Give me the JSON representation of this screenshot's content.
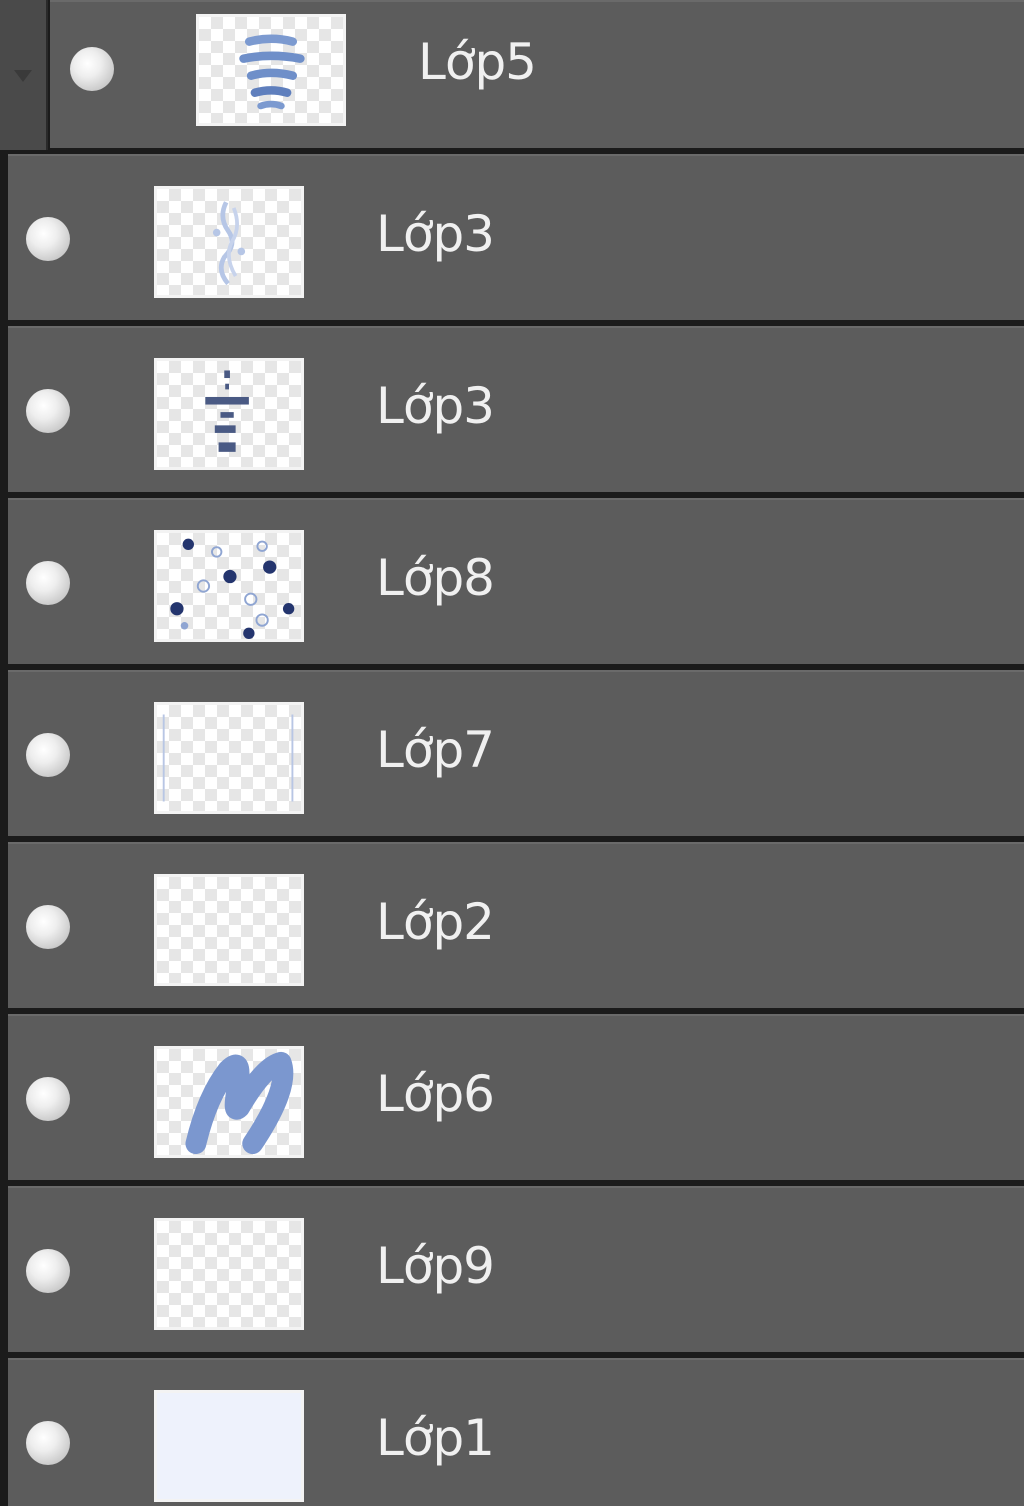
{
  "layers_panel": {
    "layers": [
      {
        "name": "Lớp5",
        "visible": true,
        "thumbnail": "stacked-blue-strokes",
        "nested": true
      },
      {
        "name": "Lớp3",
        "visible": true,
        "thumbnail": "faint-vertical-sketch"
      },
      {
        "name": "Lớp3",
        "visible": true,
        "thumbnail": "small-text-column"
      },
      {
        "name": "Lớp8",
        "visible": true,
        "thumbnail": "scattered-dots"
      },
      {
        "name": "Lớp7",
        "visible": true,
        "thumbnail": "faint-side-lines"
      },
      {
        "name": "Lớp2",
        "visible": true,
        "thumbnail": "empty-transparent"
      },
      {
        "name": "Lớp6",
        "visible": true,
        "thumbnail": "blue-n-stroke"
      },
      {
        "name": "Lớp9",
        "visible": true,
        "thumbnail": "empty-transparent"
      },
      {
        "name": "Lớp1",
        "visible": true,
        "thumbnail": "solid-pale-fill"
      }
    ],
    "colors": {
      "row_background": "#5c5c5c",
      "separator": "#1b1b1b",
      "label": "#f0f0f0",
      "thumb_stroke_blue": "#6f8fc9",
      "thumb_dot_navy": "#24356e"
    }
  }
}
